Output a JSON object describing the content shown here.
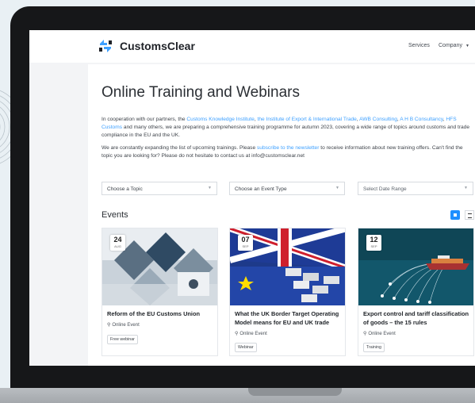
{
  "brand": {
    "name": "CustomsClear"
  },
  "nav": {
    "services": "Services",
    "company": "Company"
  },
  "page": {
    "title": "Online Training and Webinars",
    "intro1": {
      "prefix": "In cooperation with our partners, the ",
      "link1": "Customs Knowledge Institute",
      "sep1": ", ",
      "link2": "the Institute of Export & International Trade",
      "sep2": ", ",
      "link3": "AWB Consulting",
      "sep3": ", ",
      "link4": "A H B Consultancy",
      "sep4": ", ",
      "link5": "HFS Customs",
      "suffix": " and many others, we are preparing a comprehensive training programme for autumn 2023, covering a wide range of topics around customs and trade compliance in the EU and the UK."
    },
    "intro2": {
      "prefix": "We are constantly expanding the list of upcoming trainings. Please ",
      "link": "subscribe to the newsletter",
      "suffix": " to receive information about new training offers. Can't find the topic you are looking for? Please do not hesitate to contact us at info@customsclear.net"
    }
  },
  "filters": {
    "topic": "Choose a Topic",
    "event_type": "Choose an Event Type",
    "date_range": "Select Date Range"
  },
  "events": {
    "heading": "Events",
    "items": [
      {
        "day": "24",
        "month": "AUG",
        "title": "Reform of the EU Customs Union",
        "location": "Online Event",
        "tag": "Free webinar"
      },
      {
        "day": "07",
        "month": "SEP",
        "title": "What the UK Border Target Operating Model means for EU and UK trade",
        "location": "Online Event",
        "tag": "Webinar"
      },
      {
        "day": "12",
        "month": "SEP",
        "title": "Export control and tariff classification of goods – the 15 rules",
        "location": "Online Event",
        "tag": "Training"
      }
    ]
  },
  "colors": {
    "accent": "#3ea0ff",
    "primary": "#1e8fff",
    "bezel": "#161719",
    "background": "#e9f0f4"
  }
}
